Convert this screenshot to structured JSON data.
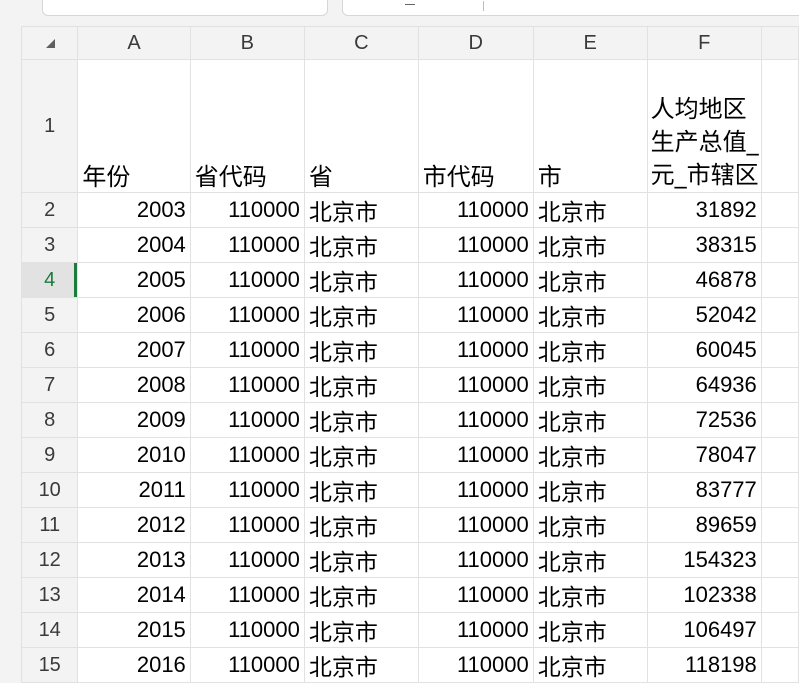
{
  "columns": [
    "A",
    "B",
    "C",
    "D",
    "E",
    "F"
  ],
  "header_row": {
    "row_number": "1",
    "cells": [
      "年份",
      "省代码",
      "省",
      "市代码",
      "市",
      "人均地区生产总值_元_市辖区"
    ]
  },
  "rows": [
    {
      "row": "2",
      "cells": [
        "2003",
        "110000",
        "北京市",
        "110000",
        "北京市",
        "31892"
      ]
    },
    {
      "row": "3",
      "cells": [
        "2004",
        "110000",
        "北京市",
        "110000",
        "北京市",
        "38315"
      ]
    },
    {
      "row": "4",
      "cells": [
        "2005",
        "110000",
        "北京市",
        "110000",
        "北京市",
        "46878"
      ]
    },
    {
      "row": "5",
      "cells": [
        "2006",
        "110000",
        "北京市",
        "110000",
        "北京市",
        "52042"
      ]
    },
    {
      "row": "6",
      "cells": [
        "2007",
        "110000",
        "北京市",
        "110000",
        "北京市",
        "60045"
      ]
    },
    {
      "row": "7",
      "cells": [
        "2008",
        "110000",
        "北京市",
        "110000",
        "北京市",
        "64936"
      ]
    },
    {
      "row": "8",
      "cells": [
        "2009",
        "110000",
        "北京市",
        "110000",
        "北京市",
        "72536"
      ]
    },
    {
      "row": "9",
      "cells": [
        "2010",
        "110000",
        "北京市",
        "110000",
        "北京市",
        "78047"
      ]
    },
    {
      "row": "10",
      "cells": [
        "2011",
        "110000",
        "北京市",
        "110000",
        "北京市",
        "83777"
      ]
    },
    {
      "row": "11",
      "cells": [
        "2012",
        "110000",
        "北京市",
        "110000",
        "北京市",
        "89659"
      ]
    },
    {
      "row": "12",
      "cells": [
        "2013",
        "110000",
        "北京市",
        "110000",
        "北京市",
        "154323"
      ]
    },
    {
      "row": "13",
      "cells": [
        "2014",
        "110000",
        "北京市",
        "110000",
        "北京市",
        "102338"
      ]
    },
    {
      "row": "14",
      "cells": [
        "2015",
        "110000",
        "北京市",
        "110000",
        "北京市",
        "106497"
      ]
    },
    {
      "row": "15",
      "cells": [
        "2016",
        "110000",
        "北京市",
        "110000",
        "北京市",
        "118198"
      ]
    }
  ],
  "active_row": "4",
  "colors": {
    "accent": "#1d7a3f",
    "header_bg": "#f3f3f3",
    "grid_line": "#e1e1e1"
  }
}
